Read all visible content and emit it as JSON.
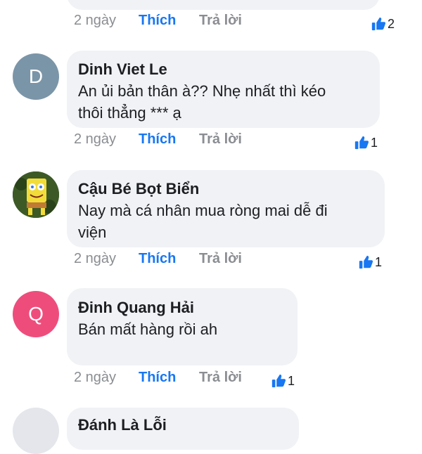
{
  "colors": {
    "bubble": "#f0f2f5",
    "like_blue": "#1877f2",
    "meta_gray": "#8a8d91",
    "avatar_d": "#7b95a8",
    "avatar_q": "#ee4d7c"
  },
  "top_comment": {
    "time": "2 ngày",
    "like_label": "Thích",
    "reply_label": "Trả lời",
    "reaction_count": "2"
  },
  "comments": [
    {
      "avatar_letter": "D",
      "name": "Dinh Viet Le",
      "text_lines": [
        "An ủi bản thân à?? Nhẹ nhất thì kéo",
        "thôi thẳng *** ạ"
      ],
      "time": "2 ngày",
      "like_label": "Thích",
      "reply_label": "Trả lời",
      "reaction_count": "1"
    },
    {
      "avatar_icon": "spongebob-avatar",
      "name": "Cậu Bé Bọt Biển",
      "text_lines": [
        "Nay mà cá nhân mua ròng mai dễ đi",
        "viện"
      ],
      "time": "2 ngày",
      "like_label": "Thích",
      "reply_label": "Trả lời",
      "reaction_count": "1"
    },
    {
      "avatar_letter": "Q",
      "name": "Đinh Quang Hải",
      "text_lines": [
        "Bán mất hàng rồi ah"
      ],
      "time": "2 ngày",
      "like_label": "Thích",
      "reply_label": "Trả lời",
      "reaction_count": "1"
    }
  ],
  "bottom_partial": {
    "name": "Đánh Là Lỗi"
  }
}
